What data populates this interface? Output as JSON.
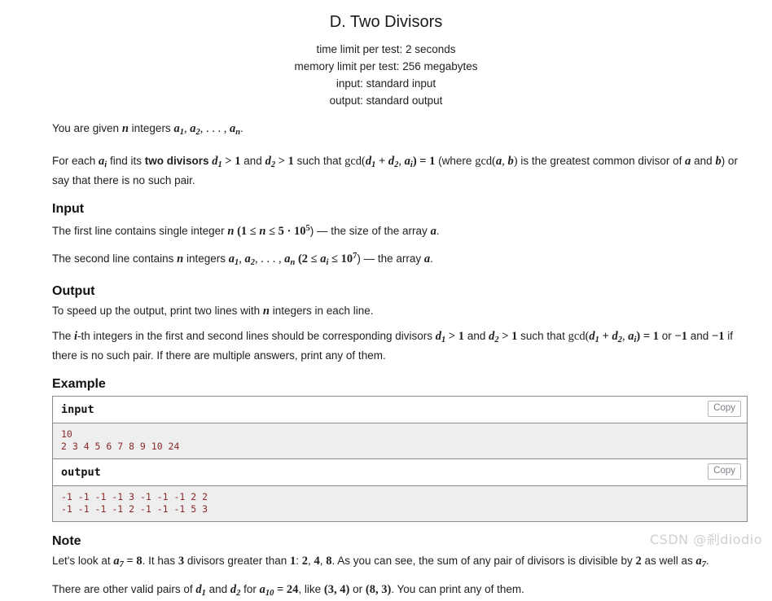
{
  "header": {
    "title": "D. Two Divisors",
    "time_limit": "time limit per test: 2 seconds",
    "memory_limit": "memory limit per test: 256 megabytes",
    "input_spec": "input: standard input",
    "output_spec": "output: standard output"
  },
  "statement": {
    "p1_a": "You are given ",
    "p1_n": "n",
    "p1_b": " integers ",
    "p1_seq": "a",
    "p1_sub1": "1",
    "p1_c": ", ",
    "p1_seq2": "a",
    "p1_sub2": "2",
    "p1_d": ", . . . , ",
    "p1_seq3": "a",
    "p1_sub3": "n",
    "p1_e": ".",
    "p2_a": "For each ",
    "p2_ai": "a",
    "p2_ai_sub": "i",
    "p2_b": " find its ",
    "p2_bold": "two divisors",
    "p2_c": " ",
    "p2_d1": "d",
    "p2_d1_sub": "1",
    "p2_gt1": " > 1",
    "p2_and": " and ",
    "p2_d2": "d",
    "p2_d2_sub": "2",
    "p2_gt2": " > 1",
    "p2_such": " such that ",
    "p2_gcd": "gcd(",
    "p2_gcd_d1": "d",
    "p2_gcd_d1_sub": "1",
    "p2_plus": " + ",
    "p2_gcd_d2": "d",
    "p2_gcd_d2_sub": "2",
    "p2_comma": ", ",
    "p2_gcd_ai": "a",
    "p2_gcd_ai_sub": "i",
    "p2_eq1": ") = 1",
    "p2_where": " (where ",
    "p2_gcdab": "gcd(",
    "p2_a_var": "a",
    "p2_ab_comma": ", ",
    "p2_b_var": "b",
    "p2_close": ")",
    "p2_tail": " is the greatest common divisor of ",
    "p2_a2": "a",
    "p2_tail_and": " and ",
    "p2_b2": "b",
    "p2_tail_end": ") or say that there is no such pair."
  },
  "input_section": {
    "heading": "Input",
    "l1_a": "The first line contains single integer ",
    "l1_n": "n",
    "l1_b": " (1 ≤ ",
    "l1_n2": "n",
    "l1_c": " ≤ 5 · 10",
    "l1_sup": "5",
    "l1_d": ") — the size of the array ",
    "l1_arr": "a",
    "l1_e": ".",
    "l2_a": "The second line contains ",
    "l2_n": "n",
    "l2_b": " integers ",
    "l2_a1": "a",
    "l2_a1_sub": "1",
    "l2_c": ", ",
    "l2_a2": "a",
    "l2_a2_sub": "2",
    "l2_d": ", . . . , ",
    "l2_an": "a",
    "l2_an_sub": "n",
    "l2_e": " (2 ≤ ",
    "l2_ai": "a",
    "l2_ai_sub": "i",
    "l2_f": " ≤ 10",
    "l2_sup": "7",
    "l2_g": ") — the array ",
    "l2_arr": "a",
    "l2_h": "."
  },
  "output_section": {
    "heading": "Output",
    "l1": "To speed up the output, print two lines with ",
    "l1_n": "n",
    "l1_b": " integers in each line.",
    "l2_a": "The ",
    "l2_i": "i",
    "l2_b": "-th integers in the first and second lines should be corresponding divisors ",
    "l2_d1": "d",
    "l2_d1_sub": "1",
    "l2_gt1": " > 1",
    "l2_and": " and ",
    "l2_d2": "d",
    "l2_d2_sub": "2",
    "l2_gt2": " > 1",
    "l2_such": " such that ",
    "l2_gcd": "gcd(",
    "l2_gd1": "d",
    "l2_gd1_sub": "1",
    "l2_plus": " + ",
    "l2_gd2": "d",
    "l2_gd2_sub": "2",
    "l2_comma": ", ",
    "l2_gai": "a",
    "l2_gai_sub": "i",
    "l2_eq": ") = 1",
    "l2_or": " or ",
    "l2_neg1": "−1",
    "l2_and2": " and ",
    "l2_neg2": "−1",
    "l2_tail": " if there is no such pair. If there are multiple answers, print any of them."
  },
  "example": {
    "heading": "Example",
    "input_label": "input",
    "output_label": "output",
    "copy_label": "Copy",
    "input_data": "10\n2 3 4 5 6 7 8 9 10 24",
    "output_data": "-1 -1 -1 -1 3 -1 -1 -1 2 2\n-1 -1 -1 -1 2 -1 -1 -1 5 3"
  },
  "note": {
    "heading": "Note",
    "l1_a": "Let's look at ",
    "l1_a7": "a",
    "l1_a7_sub": "7",
    "l1_eq8": " = 8",
    "l1_b": ". It has ",
    "l1_three": "3",
    "l1_c": " divisors greater than ",
    "l1_one": "1",
    "l1_colon": ": ",
    "l1_two": "2",
    "l1_c1": ", ",
    "l1_four": "4",
    "l1_c2": ", ",
    "l1_eight": "8",
    "l1_d": ". As you can see, the sum of any pair of divisors is divisible by ",
    "l1_two2": "2",
    "l1_e": " as well as ",
    "l1_a7b": "a",
    "l1_a7b_sub": "7",
    "l1_f": ".",
    "l2_a": "There are other valid pairs of ",
    "l2_d1": "d",
    "l2_d1_sub": "1",
    "l2_and": " and ",
    "l2_d2": "d",
    "l2_d2_sub": "2",
    "l2_for": " for ",
    "l2_a10": "a",
    "l2_a10_sub": "10",
    "l2_eq24": " = 24",
    "l2_like": ", like ",
    "l2_p1": "(3, 4)",
    "l2_or": " or ",
    "l2_p2": "(8, 3)",
    "l2_tail": ". You can print any of them."
  },
  "watermark": {
    "text": "CSDN @剎diodio"
  },
  "colors": {
    "sample_data_text": "#8b2a2a",
    "sample_data_bg": "#eeeeee",
    "border": "#888a8c",
    "copy_text": "#7a7f85"
  }
}
